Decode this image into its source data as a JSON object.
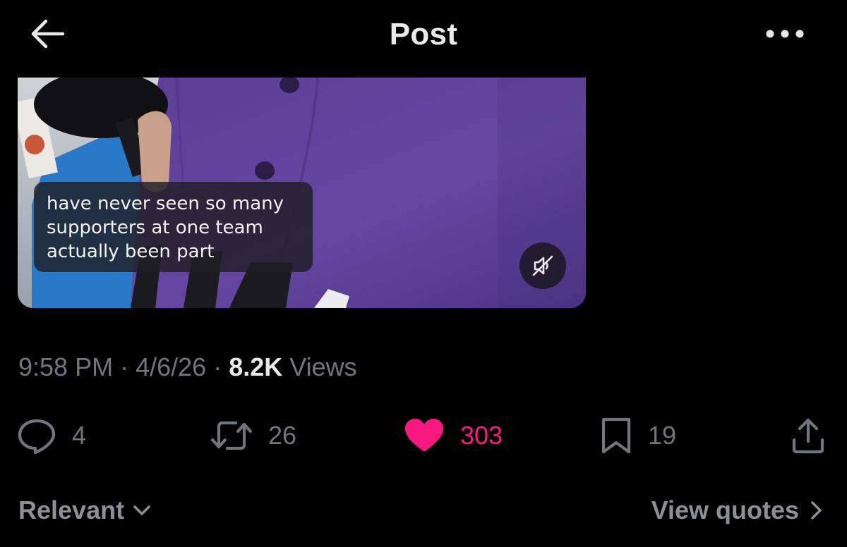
{
  "header": {
    "title": "Post",
    "back_icon": "arrow-left-icon",
    "more_icon": "more-horizontal-icon"
  },
  "video": {
    "caption_lines": [
      "have never seen so many",
      "supporters at one team",
      "actually been part"
    ],
    "mute_icon": "speaker-muted-icon",
    "jersey_color": "#5b3d94"
  },
  "meta": {
    "time": "9:58 PM",
    "separator": "·",
    "date": "4/6/26",
    "views_count": "8.2K",
    "views_label": "Views"
  },
  "actions": {
    "replies": "4",
    "reposts": "26",
    "likes": "303",
    "bookmarks": "19",
    "like_color": "#f91880"
  },
  "footer": {
    "sort_label": "Relevant",
    "quotes_label": "View quotes"
  }
}
